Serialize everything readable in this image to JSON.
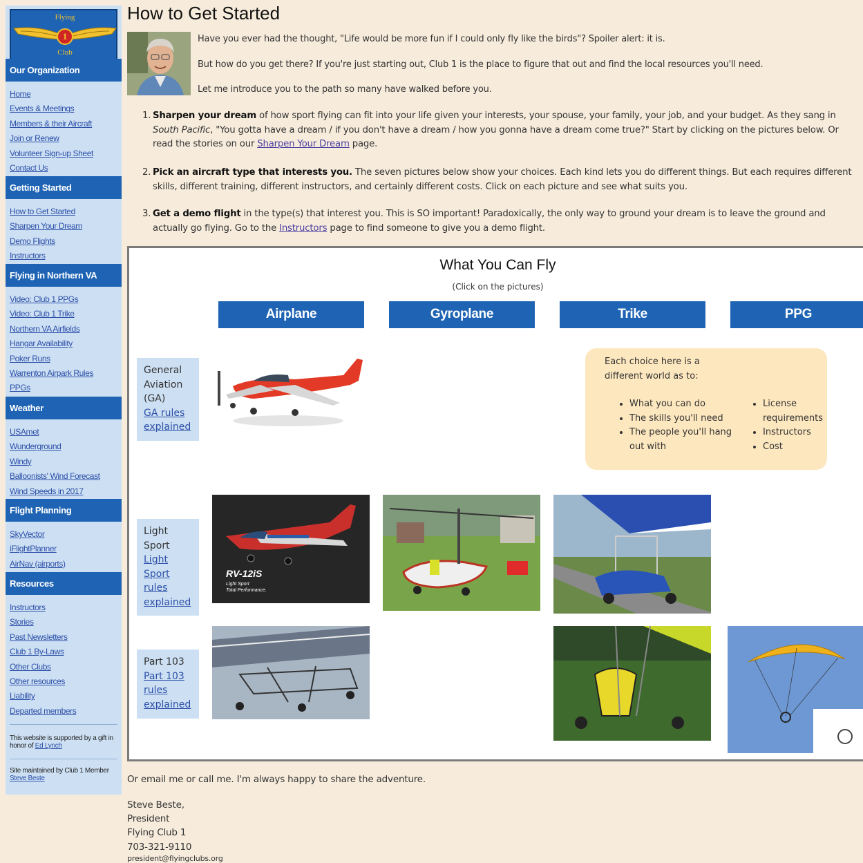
{
  "logo": {
    "top_text": "Flying",
    "number": "1",
    "bottom_text": "Club"
  },
  "sidebar": {
    "sections": [
      {
        "title": "Our Organization",
        "items": [
          "Home",
          "Events & Meetings",
          "Members & their Aircraft",
          "Join or Renew",
          "Volunteer Sign-up Sheet",
          "Contact Us"
        ]
      },
      {
        "title": "Getting Started",
        "items": [
          "How to Get Started",
          "Sharpen Your Dream",
          "Demo Flights",
          "Instructors"
        ]
      },
      {
        "title": "Flying in Northern VA",
        "items": [
          "Video: Club 1 PPGs",
          "Video: Club 1 Trike",
          "Northern VA Airfields",
          "Hangar Availability",
          "Poker Runs",
          "Warrenton Airpark Rules",
          "PPGs"
        ]
      },
      {
        "title": "Weather",
        "items": [
          "USAmet",
          "Wunderground",
          "Windy",
          "Balloonists' Wind Forecast",
          "Wind Speeds in 2017"
        ]
      },
      {
        "title": "Flight Planning",
        "items": [
          "SkyVector",
          "iFlightPlanner",
          "AirNav (airports)"
        ]
      },
      {
        "title": "Resources",
        "items": [
          "Instructors",
          "Stories",
          "Past Newsletters",
          "Club 1 By-Laws",
          "Other Clubs",
          "Other resources",
          "Liability",
          "Departed members"
        ]
      }
    ],
    "support_note": "This website is supported by a gift in honor of",
    "support_link": "Ed Lynch",
    "maintained_note": "Site maintained by Club 1 Member",
    "maintained_link": "Steve Beste"
  },
  "page": {
    "title": "How to Get Started",
    "intro": [
      "Have you ever had the thought, \"Life would be more fun if I could only fly like the birds\"? Spoiler alert: it is.",
      "But how do you get there? If you're just starting out, Club 1 is the place to figure that out and find the local resources you'll need.",
      "Let me introduce you to the path so many have walked before you."
    ],
    "steps": [
      {
        "num": "1.",
        "bold": "Sharpen your dream",
        "text_a": " of how sport flying can fit into your life given your interests, your spouse, your family, your job, and your budget. As they sang in ",
        "italic": "South Pacific",
        "text_b": ", \"You gotta have a dream / if you don't have a dream / how you gonna have a dream come true?\" Start by clicking on the pictures below. Or read the stories on our ",
        "link": "Sharpen Your Dream",
        "text_c": " page."
      },
      {
        "num": "2.",
        "bold": "Pick an aircraft type that interests you.",
        "text_a": " The seven pictures below show your choices. Each kind lets you do different things. But each requires different skills, different training, different instructors, and certainly different costs. Click on each picture and see what suits you."
      },
      {
        "num": "3.",
        "bold": "Get a demo flight",
        "text_a": " in the type(s) that interest you. This is SO important! Paradoxically, the only way to ground your dream is to leave the ground and actually go flying. Go to the ",
        "link": "Instructors",
        "text_c": " page to find someone to give you a demo flight."
      }
    ]
  },
  "panel": {
    "title": "What You Can Fly",
    "subtitle": "(Click on the pictures)",
    "types": [
      "Airplane",
      "Gyroplane",
      "Trike",
      "PPG"
    ],
    "categories": [
      {
        "lines": [
          "General",
          "Aviation",
          "(GA)"
        ],
        "link_lines": [
          "GA rules",
          "explained"
        ]
      },
      {
        "lines": [
          "Light",
          "Sport"
        ],
        "link_lines": [
          "Light",
          "Sport",
          "rules",
          "explained"
        ]
      },
      {
        "lines": [
          "Part 103"
        ],
        "link_lines": [
          "Part 103",
          "rules",
          "explained"
        ]
      }
    ],
    "photo_captions": {
      "rv_model": "RV-12iS",
      "rv_tagline1": "Light Sport",
      "rv_tagline2": "Total Performance."
    },
    "info": {
      "intro": "Each choice here is a different world as to:",
      "left_list": [
        "What you can do",
        "The skills you'll need",
        "The people you'll hang out with"
      ],
      "right_list": [
        "License requirements",
        "Instructors",
        "Cost"
      ]
    }
  },
  "footer": {
    "line": "Or email me or call me. I'm always happy to share the adventure.",
    "name": "Steve Beste,",
    "role": "President",
    "org": "Flying Club 1",
    "phone": "703-321-9110",
    "email": "president@flyingclubs.org"
  }
}
